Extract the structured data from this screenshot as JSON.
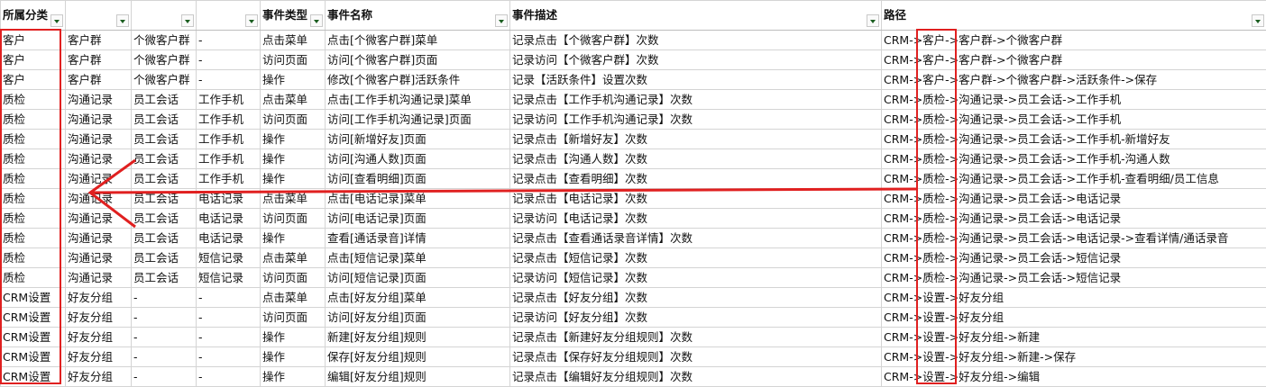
{
  "headers": [
    {
      "label": "所属分类"
    },
    {
      "label": ""
    },
    {
      "label": ""
    },
    {
      "label": ""
    },
    {
      "label": "事件类型"
    },
    {
      "label": "事件名称"
    },
    {
      "label": "事件描述"
    },
    {
      "label": "路径"
    }
  ],
  "rows": [
    [
      "客户",
      "客户群",
      "个微客户群",
      "-",
      "点击菜单",
      "点击[个微客户群]菜单",
      "记录点击【个微客户群】次数",
      "CRM->客户->客户群->个微客户群"
    ],
    [
      "客户",
      "客户群",
      "个微客户群",
      "-",
      "访问页面",
      "访问[个微客户群]页面",
      "记录访问【个微客户群】次数",
      "CRM->客户->客户群->个微客户群"
    ],
    [
      "客户",
      "客户群",
      "个微客户群",
      "-",
      "操作",
      "修改[个微客户群]活跃条件",
      "记录【活跃条件】设置次数",
      "CRM->客户->客户群->个微客户群->活跃条件->保存"
    ],
    [
      "质检",
      "沟通记录",
      "员工会话",
      "工作手机",
      "点击菜单",
      "点击[工作手机沟通记录]菜单",
      "记录点击【工作手机沟通记录】次数",
      "CRM->质检->沟通记录->员工会话->工作手机"
    ],
    [
      "质检",
      "沟通记录",
      "员工会话",
      "工作手机",
      "访问页面",
      "访问[工作手机沟通记录]页面",
      "记录访问【工作手机沟通记录】次数",
      "CRM->质检->沟通记录->员工会话->工作手机"
    ],
    [
      "质检",
      "沟通记录",
      "员工会话",
      "工作手机",
      "操作",
      "访问[新增好友]页面",
      "记录点击【新增好友】次数",
      "CRM->质检->沟通记录->员工会话->工作手机-新增好友"
    ],
    [
      "质检",
      "沟通记录",
      "员工会话",
      "工作手机",
      "操作",
      "访问[沟通人数]页面",
      "记录点击【沟通人数】次数",
      "CRM->质检->沟通记录->员工会话->工作手机-沟通人数"
    ],
    [
      "质检",
      "沟通记录",
      "员工会话",
      "工作手机",
      "操作",
      "访问[查看明细]页面",
      "记录点击【查看明细】次数",
      "CRM->质检->沟通记录->员工会话->工作手机-查看明细/员工信息"
    ],
    [
      "质检",
      "沟通记录",
      "员工会话",
      "电话记录",
      "点击菜单",
      "点击[电话记录]菜单",
      "记录点击【电话记录】次数",
      "CRM->质检->沟通记录->员工会话->电话记录"
    ],
    [
      "质检",
      "沟通记录",
      "员工会话",
      "电话记录",
      "访问页面",
      "访问[电话记录]页面",
      "记录访问【电话记录】次数",
      "CRM->质检->沟通记录->员工会话->电话记录"
    ],
    [
      "质检",
      "沟通记录",
      "员工会话",
      "电话记录",
      "操作",
      "查看[通话录音]详情",
      "记录点击【查看通话录音详情】次数",
      "CRM->质检->沟通记录->员工会话->电话记录->查看详情/通话录音"
    ],
    [
      "质检",
      "沟通记录",
      "员工会话",
      "短信记录",
      "点击菜单",
      "点击[短信记录]菜单",
      "记录点击【短信记录】次数",
      "CRM->质检->沟通记录->员工会话->短信记录"
    ],
    [
      "质检",
      "沟通记录",
      "员工会话",
      "短信记录",
      "访问页面",
      "访问[短信记录]页面",
      "记录访问【短信记录】次数",
      "CRM->质检->沟通记录->员工会话->短信记录"
    ],
    [
      "CRM设置",
      "好友分组",
      "-",
      "-",
      "点击菜单",
      "点击[好友分组]菜单",
      "记录点击【好友分组】次数",
      "CRM->设置->好友分组"
    ],
    [
      "CRM设置",
      "好友分组",
      "-",
      "-",
      "访问页面",
      "访问[好友分组]页面",
      "记录访问【好友分组】次数",
      "CRM->设置->好友分组"
    ],
    [
      "CRM设置",
      "好友分组",
      "-",
      "-",
      "操作",
      "新建[好友分组]规则",
      "记录点击【新建好友分组规则】次数",
      "CRM->设置->好友分组->新建"
    ],
    [
      "CRM设置",
      "好友分组",
      "-",
      "-",
      "操作",
      "保存[好友分组]规则",
      "记录点击【保存好友分组规则】次数",
      "CRM->设置->好友分组->新建->保存"
    ],
    [
      "CRM设置",
      "好友分组",
      "-",
      "-",
      "操作",
      "编辑[好友分组]规则",
      "记录点击【编辑好友分组规则】次数",
      "CRM->设置->好友分组->编辑"
    ]
  ],
  "annotation_color": "#e02020"
}
